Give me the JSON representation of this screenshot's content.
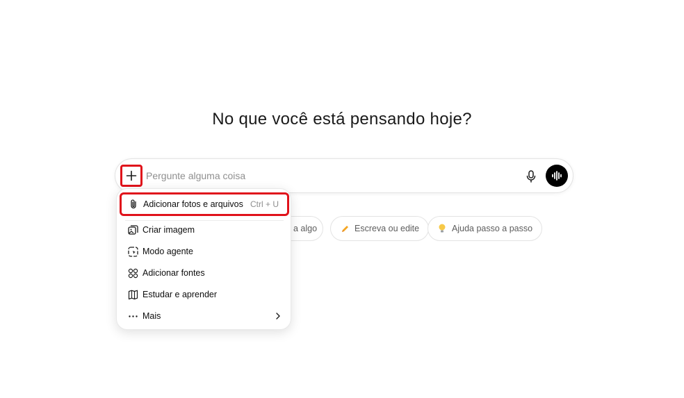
{
  "headline": "No que você está pensando hoje?",
  "composer": {
    "placeholder": "Pergunte alguma coisa",
    "value": ""
  },
  "chips": [
    {
      "label": "a algo",
      "icon": "lightbulb-icon"
    },
    {
      "label": "Escreva ou edite",
      "icon": "pencil-icon"
    },
    {
      "label": "Ajuda passo a passo",
      "icon": "lightbulb-icon"
    }
  ],
  "menu": {
    "items": [
      {
        "label": "Adicionar fotos e arquivos",
        "shortcut": "Ctrl + U",
        "icon": "paperclip-icon"
      },
      {
        "label": "Criar imagem",
        "icon": "image-icon"
      },
      {
        "label": "Modo agente",
        "icon": "agent-icon"
      },
      {
        "label": "Adicionar fontes",
        "icon": "sources-icon"
      },
      {
        "label": "Estudar e aprender",
        "icon": "book-icon"
      },
      {
        "label": "Mais",
        "icon": "more-icon"
      }
    ]
  },
  "colors": {
    "highlight": "#e0121b",
    "voice_button": "#000000",
    "pencil": "#f5a623",
    "bulb": "#f7c948"
  }
}
